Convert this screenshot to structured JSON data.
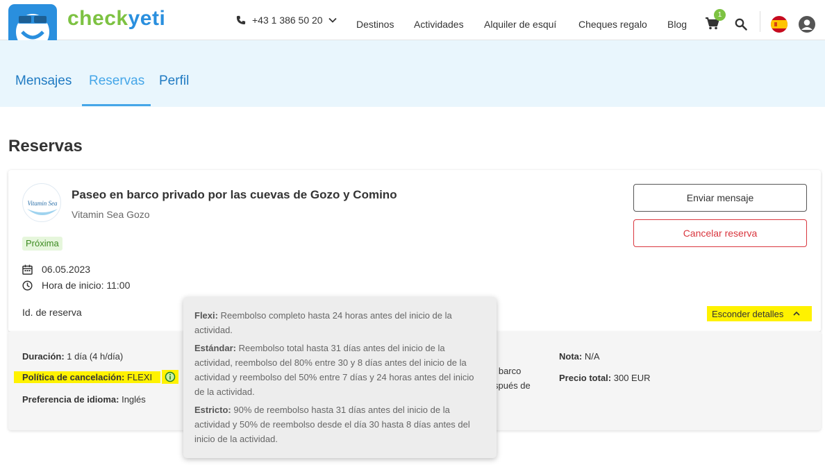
{
  "brand": {
    "part1": "check",
    "part2": "yeti"
  },
  "header": {
    "phone": "+43 1 386 50 20",
    "nav": [
      "Destinos",
      "Actividades",
      "Alquiler de esquí",
      "Cheques regalo",
      "Blog"
    ],
    "cart_count": "1"
  },
  "tabs": [
    {
      "label": "Mensajes",
      "active": false
    },
    {
      "label": "Reservas",
      "active": true
    },
    {
      "label": "Perfil",
      "active": false
    }
  ],
  "page_title": "Reservas",
  "booking": {
    "title": "Paseo en barco privado por las cuevas de Gozo y Comino",
    "vendor": "Vitamin Sea Gozo",
    "vendor_logo_text": "Vitamin Sea",
    "status": "Próxima",
    "date": "06.05.2023",
    "start_time": "Hora de inicio: 11:00",
    "booking_id_label": "Id. de reserva",
    "send_message": "Enviar mensaje",
    "cancel_booking": "Cancelar reserva",
    "hide_details": "Esconder detalles"
  },
  "details": {
    "duration_label": "Duración:",
    "duration_value": "1 día (4 h/día)",
    "cancel_policy_label": "Política de cancelación:",
    "cancel_policy_value": "FLEXI",
    "language_label": "Preferencia de idioma:",
    "language_value": "Inglés",
    "note_label": "Nota:",
    "note_value": "N/A",
    "total_label": "Precio total:",
    "total_value": "300 EUR",
    "partial_line1": "n barco",
    "partial_line2": "spués de"
  },
  "tooltip": {
    "flexi_label": "Flexi:",
    "flexi_text": "Reembolso completo hasta 24 horas antes del inicio de la actividad.",
    "standard_label": "Estándar:",
    "standard_text": "Reembolso total hasta 31 días antes del inicio de la actividad, reembolso del 80% entre 30 y 8 días antes del inicio de la actividad y reembolso del 50% entre 7 días y 24 horas antes del inicio de la actividad.",
    "strict_label": "Estricto:",
    "strict_text": "90% de reembolso hasta 31 días antes del inicio de la actividad y 50% de reembolso desde el día 30 hasta 8 días antes del inicio de la actividad."
  },
  "colors": {
    "brand_blue": "#2a8fde",
    "brand_green": "#7dc242",
    "highlight": "#fff200",
    "danger": "#d9363e"
  }
}
